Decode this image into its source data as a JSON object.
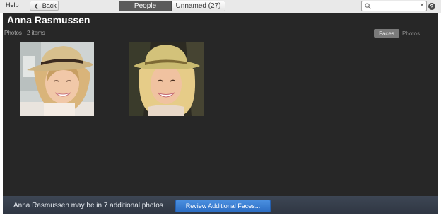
{
  "toolbar": {
    "help_label": "Help",
    "back_label": "Back",
    "back_icon": "chevron-left-icon",
    "tabs": [
      {
        "label": "People",
        "active": true
      },
      {
        "label": "Unnamed (27)",
        "active": false
      }
    ],
    "search": {
      "value": "",
      "placeholder": "",
      "icon": "search-icon",
      "clear_glyph": "×"
    },
    "help_glyph": "?"
  },
  "person": {
    "name": "Anna Rasmussen",
    "subtitle": "Photos · 2 items"
  },
  "view_toggle": {
    "options": [
      {
        "label": "Faces",
        "selected": true
      },
      {
        "label": "Photos",
        "selected": false
      }
    ]
  },
  "photos": [
    {
      "kind": "face-thumbnail"
    },
    {
      "kind": "face-thumbnail"
    }
  ],
  "suggestion_bar": {
    "message": "Anna Rasmussen may be in 7 additional photos",
    "button_label": "Review Additional Faces..."
  },
  "colors": {
    "panel_bg": "#272727",
    "accent": "#3a7fd5",
    "bottom_bar": "#353d4a"
  }
}
